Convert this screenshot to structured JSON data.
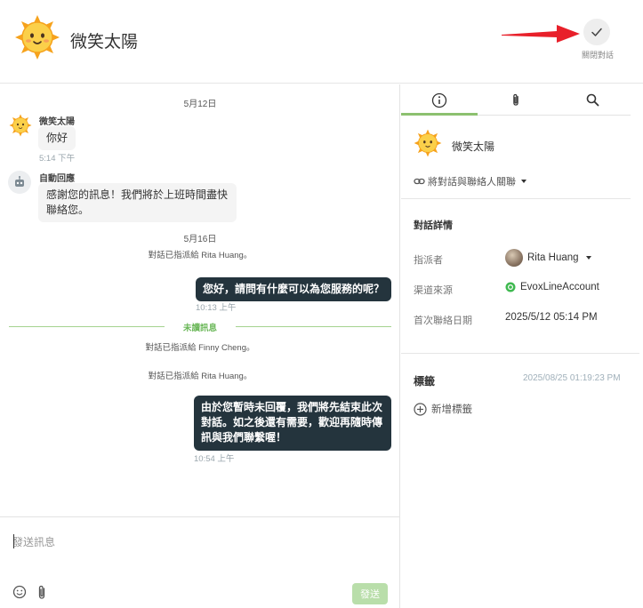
{
  "header": {
    "contact_name": "微笑太陽",
    "close_label": "關閉對話"
  },
  "chat": {
    "date1": "5月12日",
    "msg1": {
      "sender": "微笑太陽",
      "text": "你好",
      "time": "5:14 下午"
    },
    "msg2": {
      "sender": "自動回應",
      "text_line1": "感謝您的訊息！我們將於上班時間盡快",
      "text_line2": "聯絡您。"
    },
    "date2": "5月16日",
    "sys1": "對話已指派給 Rita Huang。",
    "msg3": {
      "text": "您好，請問有什麼可以為您服務的呢？",
      "time": "10:13 上午"
    },
    "unread": "未讀訊息",
    "sys2": "對話已指派給 Finny Cheng。",
    "sys3": "對話已指派給 Rita Huang。",
    "msg4": {
      "text_line1": "由於您暫時未回覆，我們將先結束此次",
      "text_line2": "對話。如之後還有需要，歡迎再隨時傳",
      "text_line3": "訊與我們聯繫喔！",
      "time": "10:54 上午"
    }
  },
  "composer": {
    "placeholder": "發送訊息",
    "send_label": "發送"
  },
  "side": {
    "tabs": [
      {
        "name": "info",
        "icon": "info-icon"
      },
      {
        "name": "attachments",
        "icon": "paperclip-icon"
      },
      {
        "name": "search",
        "icon": "search-icon"
      }
    ],
    "contact_name": "微笑太陽",
    "link_label": "將對話與聯絡人關聯",
    "details_title": "對話詳情",
    "assignee_label": "指派者",
    "assignee_value": "Rita Huang",
    "channel_label": "渠道來源",
    "channel_value": "EvoxLineAccount",
    "first_contact_label": "首次聯絡日期",
    "first_contact_value": "2025/5/12 05:14 PM",
    "tags_title": "標籤",
    "tags_time": "2025/08/25 01:19:23 PM",
    "add_tag_label": "新增標籤"
  },
  "colors": {
    "accent": "#8cc06f",
    "dark_bubble": "#24343d",
    "arrow": "#e8202a",
    "line_green": "#3fb950"
  }
}
